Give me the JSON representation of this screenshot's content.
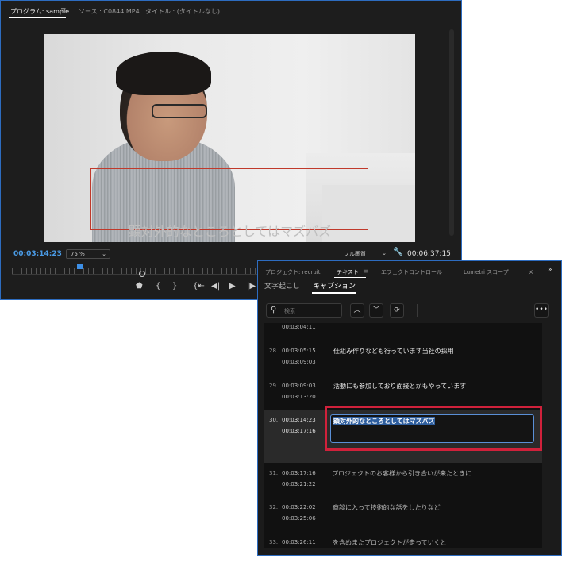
{
  "program_monitor": {
    "tabs": [
      {
        "label": "プログラム: sample",
        "active": true
      },
      {
        "label": "ソース : C0844.MP4",
        "active": false
      },
      {
        "label": "タイトル : (タイトルなし)",
        "active": false
      }
    ],
    "menu_icon": "hamburger-icon",
    "video_caption": "顕対外的なところとしてはマズバズ",
    "current_timecode": "00:03:14:23",
    "zoom_level": "75 %",
    "quality": "フル画質",
    "duration": "00:06:37:15",
    "playhead_fraction": 0.488,
    "accent_color": "#4a9be6"
  },
  "text_panel": {
    "tabs": [
      {
        "label": "プロジェクト: recruit",
        "active": false
      },
      {
        "label": "テキスト",
        "active": true
      },
      {
        "label": "エフェクトコントロール",
        "active": false
      },
      {
        "label": "Lumetri スコープ",
        "active": false
      },
      {
        "label": "メ",
        "active": false
      }
    ],
    "overflow_label": "»",
    "subtabs": [
      {
        "label": "文字起こし",
        "active": false
      },
      {
        "label": "キャプション",
        "active": true
      }
    ],
    "search": {
      "placeholder": "検索",
      "value": ""
    },
    "captions": [
      {
        "num": "",
        "start": "",
        "end": "00:03:04:11",
        "text": ""
      },
      {
        "num": "28.",
        "start": "00:03:05:15",
        "end": "00:03:09:03",
        "text": "仕組み作りなども行っています当社の採用"
      },
      {
        "num": "29.",
        "start": "00:03:09:03",
        "end": "00:03:13:20",
        "text": "活動にも参加しており面接とかもやっています"
      },
      {
        "num": "30.",
        "start": "00:03:14:23",
        "end": "00:03:17:16",
        "text": "顕対外的なところとしてはマズバズ",
        "selected": true
      },
      {
        "num": "31.",
        "start": "00:03:17:16",
        "end": "00:03:21:22",
        "text": "プロジェクトのお客様から引き合いが来たときに"
      },
      {
        "num": "32.",
        "start": "00:03:22:02",
        "end": "00:03:25:06",
        "text": "商談に入って技術的な話をしたりなど"
      },
      {
        "num": "33.",
        "start": "00:03:26:11",
        "end": "",
        "text": "を含めまたプロジェクトが走っていくと"
      }
    ],
    "highlight_color": "#d0213b"
  }
}
